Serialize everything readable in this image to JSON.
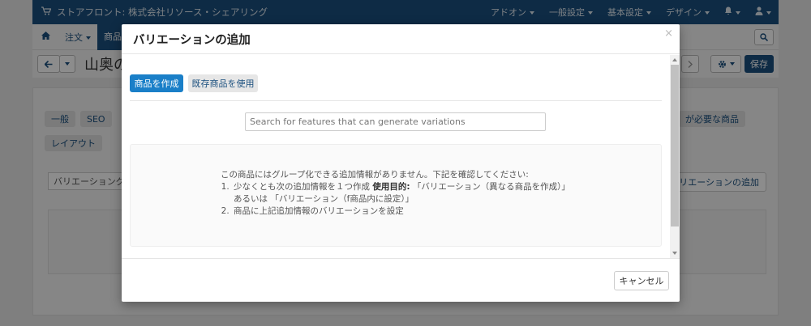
{
  "topbar": {
    "store_title": "ストアフロント: 株式会社リソース・シェアリング",
    "menus": [
      "アドオン",
      "一般設定",
      "基本設定",
      "デザイン"
    ]
  },
  "subbar": {
    "tabs": [
      "注文",
      "商品"
    ]
  },
  "title_row": {
    "page_title": "山奥の",
    "save_label": "保存"
  },
  "background_panel": {
    "tabs": [
      "一般",
      "SEO",
      "レイアウト"
    ],
    "tab_right": "が必要な商品",
    "input_value": "バリエーショングル",
    "add_variation_button": "バリエーションの追加"
  },
  "modal": {
    "title": "バリエーションの追加",
    "close_symbol": "×",
    "create_product_button": "商品を作成",
    "use_existing_button": "既存商品を使用",
    "search_placeholder": "Search for features that can generate variations",
    "info_intro": "この商品にはグループ化できる追加情報がありません。下記を確認してください:",
    "info_item1_prefix": "少なくとも次の追加情報を１つ作成 ",
    "info_item1_bold": "使用目的:",
    "info_item1_suffix": " 「バリエーション（異なる商品を作成）」 あるいは 「バリエーション（f商品内に設定）」",
    "info_item2": "商品に上記追加情報のバリエーションを設定",
    "cancel_button": "キャンセル"
  },
  "colors": {
    "navbar": "#1a4f7e",
    "primary_button": "#1a7fc8"
  }
}
